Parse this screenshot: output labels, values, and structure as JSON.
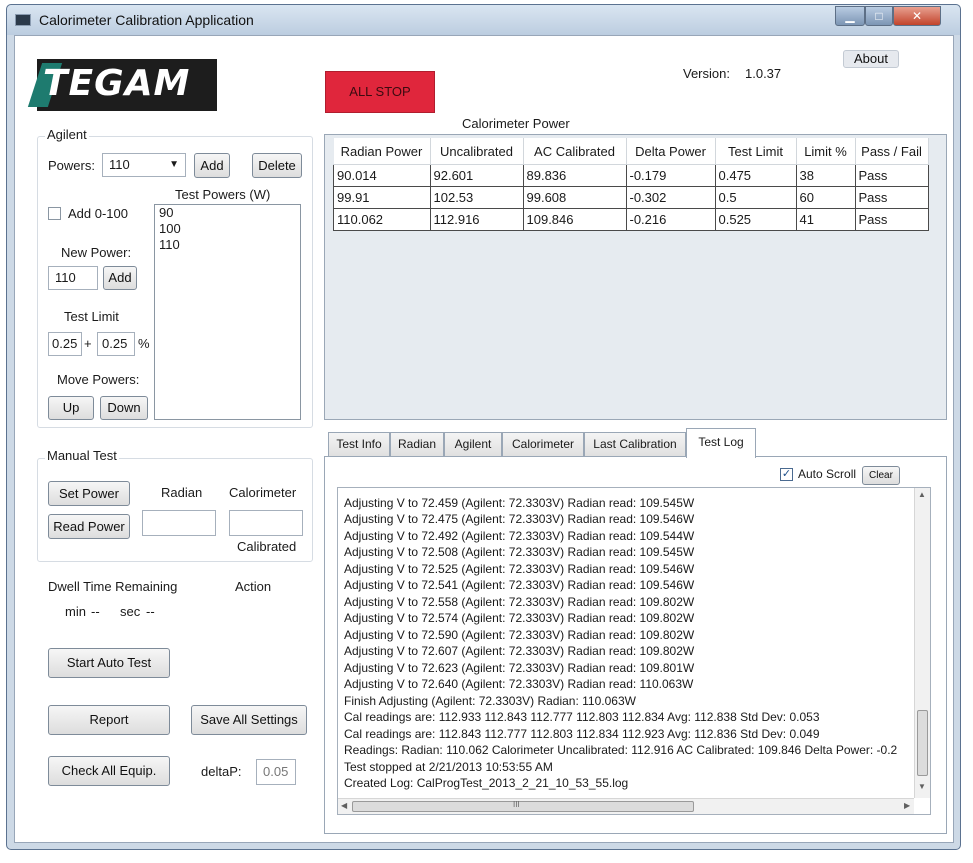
{
  "window": {
    "title": "Calorimeter Calibration Application",
    "controls": {
      "minimize": "▁",
      "maximize": "□",
      "close": "✕"
    }
  },
  "header": {
    "logo": "TEGAM",
    "all_stop": "ALL STOP",
    "version_label": "Version:",
    "version_value": "1.0.37",
    "about": "About"
  },
  "agilent": {
    "title": "Agilent",
    "powers_label": "Powers:",
    "powers_selected": "110",
    "add": "Add",
    "delete": "Delete",
    "add_range_label": "Add 0-100",
    "test_powers_label": "Test Powers (W)",
    "test_powers": [
      "90",
      "100",
      "110"
    ],
    "new_power_label": "New Power:",
    "new_power_value": "110",
    "new_power_add": "Add",
    "test_limit_label": "Test Limit",
    "test_limit_a": "0.25",
    "plus": "+",
    "test_limit_b": "0.25",
    "percent": "%",
    "move_powers_label": "Move Powers:",
    "up": "Up",
    "down": "Down"
  },
  "manual_test": {
    "title": "Manual Test",
    "set_power": "Set Power",
    "read_power": "Read Power",
    "radian_label": "Radian",
    "calorimeter_label": "Calorimeter",
    "calibrated_label": "Calibrated",
    "radian_value": "",
    "calorimeter_value": ""
  },
  "dwell": {
    "label": "Dwell Time Remaining",
    "action_label": "Action",
    "min_label": "min",
    "min_value": "--",
    "sec_label": "sec",
    "sec_value": "--"
  },
  "buttons": {
    "start_auto_test": "Start Auto Test",
    "report": "Report",
    "save_all_settings": "Save All Settings",
    "check_all_equip": "Check All Equip.",
    "deltap_label": "deltaP:",
    "deltap_value": "0.05"
  },
  "power_table": {
    "title": "Calorimeter Power",
    "columns": [
      "Radian Power",
      "Uncalibrated",
      "AC Calibrated",
      "Delta Power",
      "Test Limit",
      "Limit %",
      "Pass / Fail"
    ],
    "rows": [
      [
        "90.014",
        "92.601",
        "89.836",
        "-0.179",
        "0.475",
        "38",
        "Pass"
      ],
      [
        "99.91",
        "102.53",
        "99.608",
        "-0.302",
        "0.5",
        "60",
        "Pass"
      ],
      [
        "110.062",
        "112.916",
        "109.846",
        "-0.216",
        "0.525",
        "41",
        "Pass"
      ]
    ]
  },
  "tabs": {
    "items": [
      "Test Info",
      "Radian",
      "Agilent",
      "Calorimeter",
      "Last Calibration",
      "Test Log"
    ],
    "active": "Test Log"
  },
  "test_log": {
    "auto_scroll_label": "Auto Scroll",
    "auto_scroll_checked": true,
    "clear": "Clear",
    "lines": [
      "Adjusting V to 72.459 (Agilent: 72.3303V)  Radian read: 109.545W",
      "Adjusting V to 72.475 (Agilent: 72.3303V)  Radian read: 109.546W",
      "Adjusting V to 72.492 (Agilent: 72.3303V)  Radian read: 109.544W",
      "Adjusting V to 72.508 (Agilent: 72.3303V)  Radian read: 109.545W",
      "Adjusting V to 72.525 (Agilent: 72.3303V)  Radian read: 109.546W",
      "Adjusting V to 72.541 (Agilent: 72.3303V)  Radian read: 109.546W",
      "Adjusting V to 72.558 (Agilent: 72.3303V)  Radian read: 109.802W",
      "Adjusting V to 72.574 (Agilent: 72.3303V)  Radian read: 109.802W",
      "Adjusting V to 72.590 (Agilent: 72.3303V)  Radian read: 109.802W",
      "Adjusting V to 72.607 (Agilent: 72.3303V)  Radian read: 109.802W",
      "Adjusting V to 72.623 (Agilent: 72.3303V)  Radian read: 109.801W",
      "Adjusting V to 72.640 (Agilent: 72.3303V)  Radian read: 110.063W",
      "Finish Adjusting  (Agilent: 72.3303V)  Radian: 110.063W",
      "Cal readings are: 112.933 112.843 112.777 112.803 112.834  Avg: 112.838 Std Dev: 0.053",
      "Cal readings are: 112.843 112.777 112.803 112.834 112.923  Avg: 112.836 Std Dev: 0.049",
      "Readings: Radian: 110.062 Calorimeter Uncalibrated: 112.916 AC Calibrated: 109.846 Delta Power: -0.2",
      "Test stopped at 2/21/2013 10:53:55 AM",
      "Created Log: CalProgTest_2013_2_21_10_53_55.log"
    ],
    "hscroll_grip": "III"
  }
}
